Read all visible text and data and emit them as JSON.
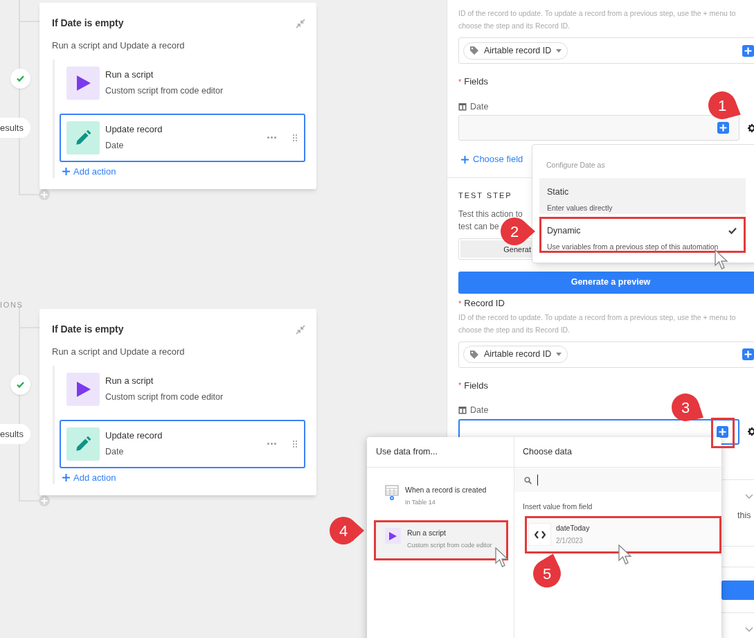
{
  "screens": [
    {
      "canvas": {
        "results_label": "esults",
        "condition": {
          "title": "If Date is empty",
          "subtitle": "Run a script and Update a record",
          "actions": [
            {
              "kind": "script",
              "title": "Run a script",
              "subtitle": "Custom script from code editor",
              "selected": false
            },
            {
              "kind": "update",
              "title": "Update record",
              "subtitle": "Date",
              "selected": true
            }
          ],
          "add_action": "Add action"
        }
      },
      "panel": {
        "record_description": "ID of the record to update. To update a record from a previous step, use the + menu to choose the step and its Record ID.",
        "record_value": "Airtable record ID",
        "fields_label": {
          "mark": "*",
          "text": "Fields"
        },
        "field": {
          "name": "Date",
          "focused": false,
          "plus_annotated": false
        },
        "choose_field": "Choose field",
        "test_step": {
          "title": "TEST STEP",
          "description_lines": [
            "Test this action to",
            "test can be"
          ],
          "generate_button": "Generat"
        },
        "preview_button": "Generate a preview"
      },
      "configure_menu": {
        "title": "Configure Date as",
        "options": [
          {
            "title": "Static",
            "description": "Enter values directly",
            "hovered": true,
            "selected": false,
            "annotated": false
          },
          {
            "title": "Dynamic",
            "description": "Use variables from a previous step of this automation",
            "hovered": false,
            "selected": true,
            "annotated": true
          }
        ]
      }
    },
    {
      "canvas": {
        "section_label": "IONS",
        "results_label": "esults",
        "condition": {
          "title": "If Date is empty",
          "subtitle": "Run a script and Update a record",
          "actions": [
            {
              "kind": "script",
              "title": "Run a script",
              "subtitle": "Custom script from code editor",
              "selected": false
            },
            {
              "kind": "update",
              "title": "Update record",
              "subtitle": "Date",
              "selected": true
            }
          ],
          "add_action": "Add action"
        }
      },
      "panel": {
        "record_label": {
          "mark": "*",
          "text": "Record ID"
        },
        "record_description": "ID of the record to update. To update a record from a previous step, use the + menu to choose the step and its Record ID.",
        "record_value": "Airtable record ID",
        "fields_label": {
          "mark": "*",
          "text": "Fields"
        },
        "field": {
          "name": "Date",
          "focused": true,
          "plus_annotated": true
        },
        "trailing_text": "this"
      },
      "data_picker": {
        "sources_title": "Use data from...",
        "sources": [
          {
            "kind": "table",
            "title": "When a record is created",
            "subtitle": "In Table 14",
            "selected": false,
            "annotated": false
          },
          {
            "kind": "script",
            "title": "Run a script",
            "subtitle": "Custom script from code editor",
            "selected": true,
            "annotated": true
          }
        ],
        "data_title": "Choose data",
        "group_label": "Insert value from field",
        "values": [
          {
            "title": "dateToday",
            "subtitle": "2/1/2023",
            "annotated": true
          }
        ]
      }
    }
  ],
  "callouts": [
    "1",
    "2",
    "3",
    "4",
    "5"
  ]
}
